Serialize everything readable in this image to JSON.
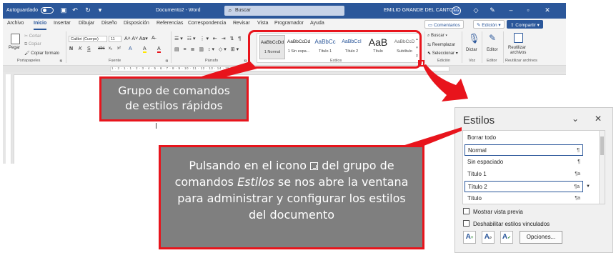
{
  "titlebar": {
    "autosave": "Autoguardado",
    "document": "Documento2 - Word",
    "search_placeholder": "Buscar",
    "user": "EMILIO GRANDE DEL CANTO",
    "avatar": "EG"
  },
  "tabs": [
    "Archivo",
    "Inicio",
    "Insertar",
    "Dibujar",
    "Diseño",
    "Disposición",
    "Referencias",
    "Correspondencia",
    "Revisar",
    "Vista",
    "Programador",
    "Ayuda"
  ],
  "tab_buttons": {
    "comments": "Comentarios",
    "edit": "Edición",
    "share": "Compartir"
  },
  "ribbon": {
    "clipboard": {
      "paste": "Pegar",
      "cut": "Cortar",
      "copy": "Copiar",
      "format": "Copiar formato",
      "label": "Portapapeles"
    },
    "font": {
      "name": "Calibri (Cuerpo)",
      "size": "11",
      "buttons": [
        "N",
        "K",
        "S",
        "abc",
        "x₂",
        "x²",
        "A",
        "A",
        "A"
      ],
      "label": "Fuente"
    },
    "paragraph": {
      "label": "Párrafo"
    },
    "styles": {
      "label": "Estilos",
      "items": [
        {
          "preview": "AaBbCcDd",
          "name": "1 Normal"
        },
        {
          "preview": "AaBbCcDd",
          "name": "1 Sin espa..."
        },
        {
          "preview": "AaBbCc",
          "name": "Título 1"
        },
        {
          "preview": "AaBbCcI",
          "name": "Título 2"
        },
        {
          "preview": "AaB",
          "name": "Título"
        },
        {
          "preview": "AaBbCcD",
          "name": "Subtítulo"
        }
      ]
    },
    "editing": {
      "find": "Buscar",
      "replace": "Reemplazar",
      "select": "Seleccionar",
      "label": "Edición"
    },
    "voice": {
      "dictate": "Dictar",
      "label": "Voz"
    },
    "editor": {
      "button": "Editor",
      "label": "Editor"
    },
    "reuse": {
      "button1": "Reutilizar",
      "button2": "archivos",
      "label": "Reutilizar archivos"
    }
  },
  "ruler": {
    "numbers": "1 · 2 · 1 · 1 · 2 · 3 · 4 · 5 · 6 · 7 · 8 · 9 · 10 · 11 · 12 · 13 · 14 · 15 · 16 · 17"
  },
  "callouts": {
    "quick_styles": {
      "line1": "Grupo de comandos",
      "line2": "de estilos rápidos"
    },
    "launcher": {
      "part1": "Pulsando en el icono",
      "part2": "del grupo de comandos",
      "italic": "Estilos",
      "part3": "se nos abre la ventana para administrar y configurar los estilos del documento"
    }
  },
  "styles_pane": {
    "title": "Estilos",
    "items": [
      {
        "name": "Borrar todo",
        "mark": ""
      },
      {
        "name": "Normal",
        "mark": "¶"
      },
      {
        "name": "Sin espaciado",
        "mark": "¶"
      },
      {
        "name": "Título 1",
        "mark": "¶a"
      },
      {
        "name": "Título 2",
        "mark": "¶a"
      },
      {
        "name": "Título",
        "mark": "¶a"
      }
    ],
    "show_preview": "Mostrar vista previa",
    "disable_linked": "Deshabilitar estilos vinculados",
    "options_button": "Opciones...",
    "colors": {
      "accent": "#2b579a",
      "highlight": "#e8141c",
      "callout_bg": "#7f7f7f"
    }
  }
}
